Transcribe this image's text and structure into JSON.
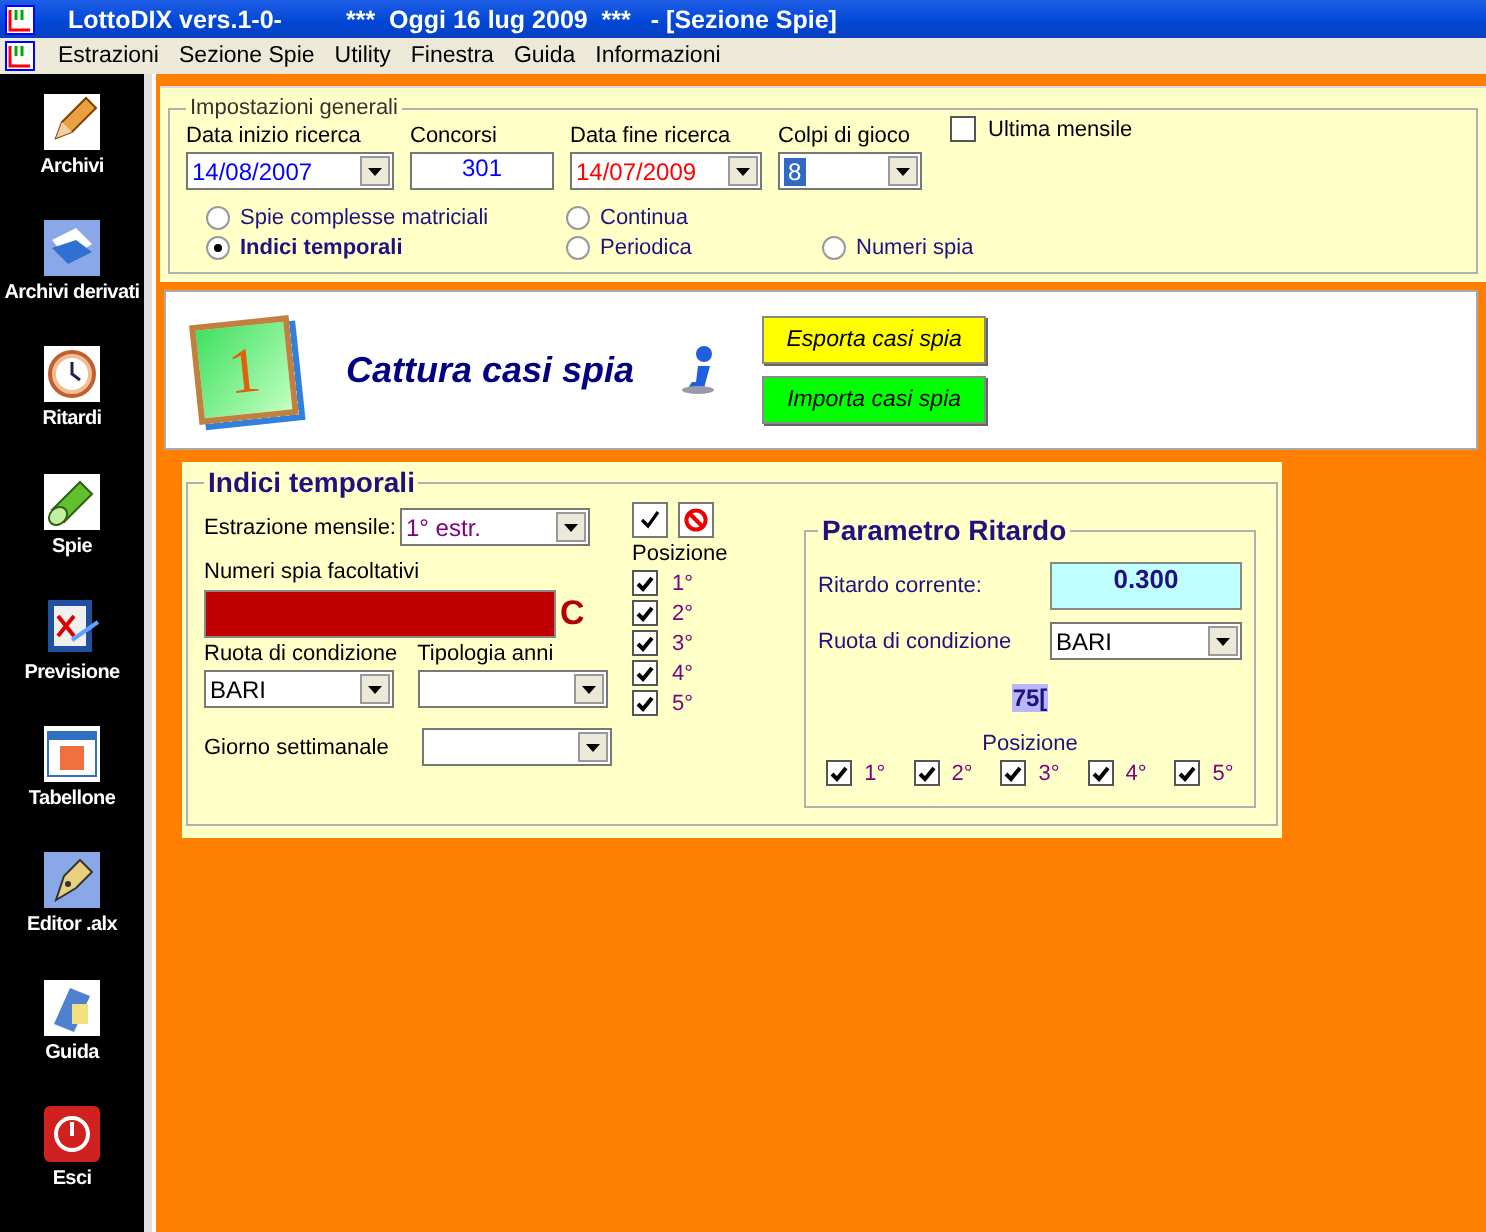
{
  "window": {
    "title": "LottoDIX vers.1-0-",
    "title_date": "***  Oggi 16 lug 2009  ***",
    "title_section": "- [Sezione Spie]"
  },
  "menu": [
    "Estrazioni",
    "Sezione Spie",
    "Utility",
    "Finestra",
    "Guida",
    "Informazioni"
  ],
  "sidebar": {
    "items": [
      {
        "label": "Archivi"
      },
      {
        "label": "Archivi derivati"
      },
      {
        "label": "Ritardi"
      },
      {
        "label": "Spie"
      },
      {
        "label": "Previsione"
      },
      {
        "label": "Tabellone"
      },
      {
        "label": "Editor .alx"
      },
      {
        "label": "Guida"
      },
      {
        "label": "Esci"
      }
    ]
  },
  "general_settings": {
    "legend": "Impostazioni generali",
    "fields": [
      {
        "label": "Data inizio ricerca",
        "value": "14/08/2007",
        "kind": "dropdown",
        "color": "#0000ff"
      },
      {
        "label": "Concorsi",
        "value": "301",
        "kind": "text",
        "color": "#0000ff"
      },
      {
        "label": "Data fine ricerca",
        "value": "14/07/2009",
        "kind": "dropdown",
        "color": "#ff0000"
      },
      {
        "label": "Colpi di gioco",
        "value": "8",
        "kind": "selected-dropdown"
      }
    ],
    "ultima_mensile": {
      "label": "Ultima mensile",
      "checked": false
    },
    "modes": [
      {
        "label": "Spie complesse matriciali",
        "selected": false
      },
      {
        "label": "Indici temporali",
        "selected": true
      }
    ],
    "range": [
      {
        "label": "Continua",
        "selected": false
      },
      {
        "label": "Periodica",
        "selected": false
      }
    ],
    "numeri_spia": {
      "label": "Numeri spia",
      "selected": false
    }
  },
  "capture": {
    "badge": "1",
    "title": "Cattura casi spia",
    "buttons": [
      {
        "label": "Esporta casi spia",
        "color": "#ffff00"
      },
      {
        "label": "Importa casi spia",
        "color": "#00ff00"
      }
    ]
  },
  "indici_temporali": {
    "legend": "Indici temporali",
    "estrazione_mensile": {
      "label": "Estrazione mensile:",
      "value": "1° estr."
    },
    "numeri_spia": {
      "label": "Numeri spia facoltativi",
      "clear": "C"
    },
    "ruota": {
      "label": "Ruota di condizione",
      "value": "BARI"
    },
    "tipologia": {
      "label": "Tipologia anni"
    },
    "giorno": {
      "label": "Giorno settimanale"
    },
    "position_label": "Posizione",
    "positions": [
      {
        "label": "1°",
        "checked": true
      },
      {
        "label": "2°",
        "checked": true
      },
      {
        "label": "3°",
        "checked": true
      },
      {
        "label": "4°",
        "checked": true
      },
      {
        "label": "5°",
        "checked": true
      }
    ]
  },
  "parametro_ritardo": {
    "legend": "Parametro Ritardo",
    "ritardo_label": "Ritardo corrente:",
    "ritardo_value": "0.300",
    "ruota_label": "Ruota di condizione",
    "ruota_value": "BARI",
    "code": "75[",
    "position_label": "Posizione",
    "positions": [
      {
        "label": "1°",
        "checked": true
      },
      {
        "label": "2°",
        "checked": true
      },
      {
        "label": "3°",
        "checked": true
      },
      {
        "label": "4°",
        "checked": true
      },
      {
        "label": "5°",
        "checked": true
      }
    ]
  }
}
